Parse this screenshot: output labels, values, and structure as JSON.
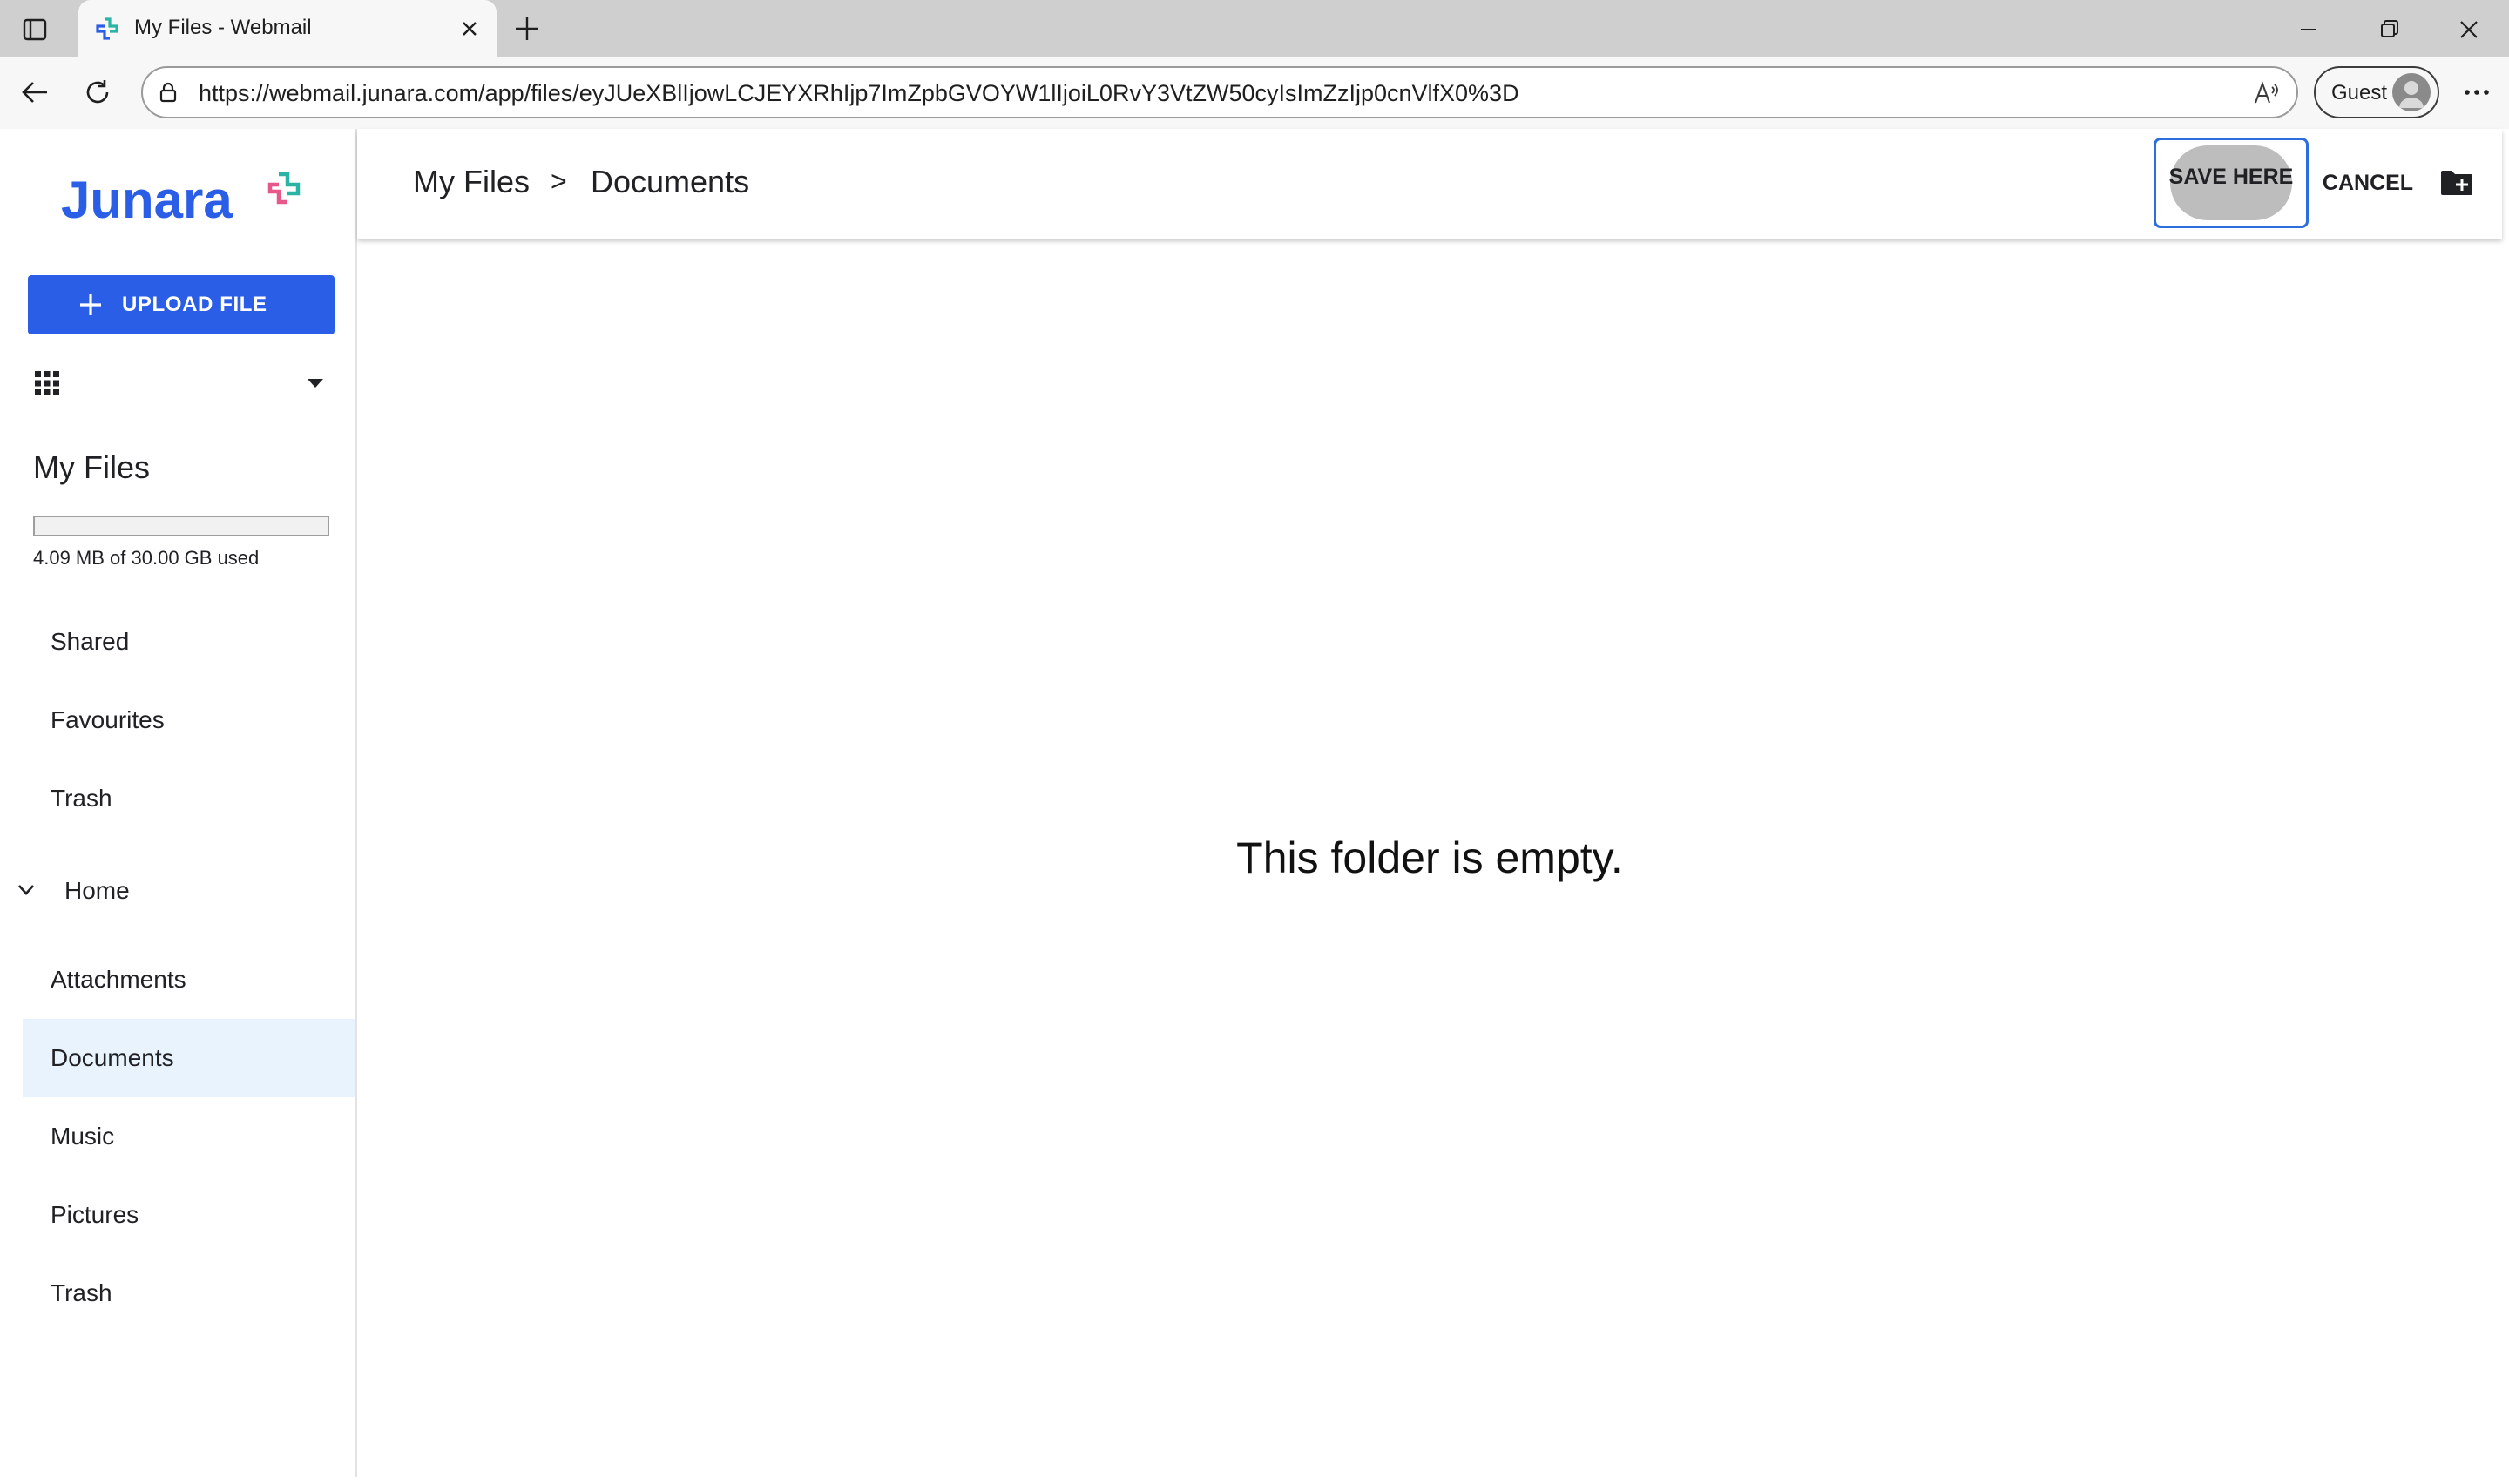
{
  "browser": {
    "tab_title": "My Files - Webmail",
    "url": "https://webmail.junara.com/app/files/eyJUeXBlIjowLCJEYXRhIjp7ImZpbGVOYW1lIjoiL0RvY3VtZW50cyIsImZzIjp0cnVlfX0%3D",
    "profile_label": "Guest"
  },
  "sidebar": {
    "logo_text": "Junara",
    "upload_label": "UPLOAD FILE",
    "title": "My Files",
    "quota_text": "4.09 MB of 30.00 GB used",
    "quota_fraction": 0.0001,
    "top_items": [
      {
        "label": "Shared"
      },
      {
        "label": "Favourites"
      },
      {
        "label": "Trash"
      }
    ],
    "home_label": "Home",
    "home_items": [
      {
        "label": "Attachments",
        "active": false
      },
      {
        "label": "Documents",
        "active": true
      },
      {
        "label": "Music",
        "active": false
      },
      {
        "label": "Pictures",
        "active": false
      },
      {
        "label": "Trash",
        "active": false
      }
    ]
  },
  "main": {
    "breadcrumb": [
      "My Files",
      "Documents"
    ],
    "breadcrumb_separator": ">",
    "save_label": "SAVE HERE",
    "cancel_label": "CANCEL",
    "empty_message": "This folder is empty."
  },
  "colors": {
    "accent": "#2b5ee6",
    "active_item_bg": "#e8f3fd",
    "logo_teal": "#2bb3a3",
    "logo_pink": "#e8578a"
  }
}
